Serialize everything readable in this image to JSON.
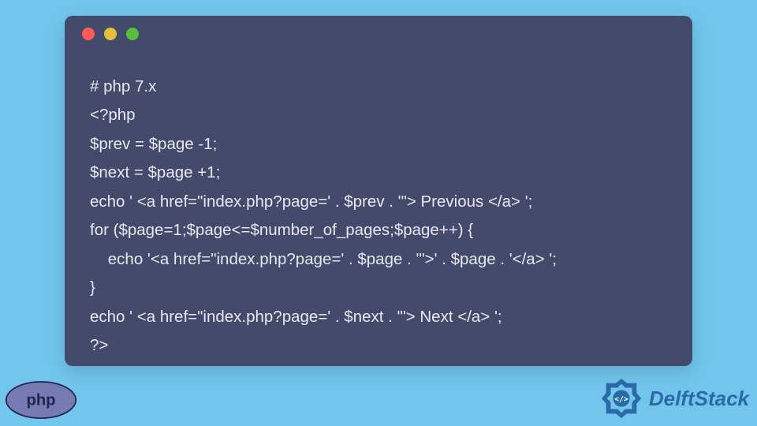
{
  "code": {
    "lines": [
      "# php 7.x",
      "<?php",
      "$prev = $page -1;",
      "$next = $page +1;",
      "echo ' <a href=\"index.php?page=' . $prev . '\"> Previous </a> ';",
      "for ($page=1;$page<=$number_of_pages;$page++) {",
      "    echo '<a href=\"index.php?page=' . $page . '\">' . $page . '</a> ';",
      "}",
      "echo ' <a href=\"index.php?page=' . $next . '\"> Next </a> ';",
      "?>"
    ]
  },
  "php_badge": {
    "label": "php"
  },
  "brand": {
    "name": "DelftStack"
  }
}
